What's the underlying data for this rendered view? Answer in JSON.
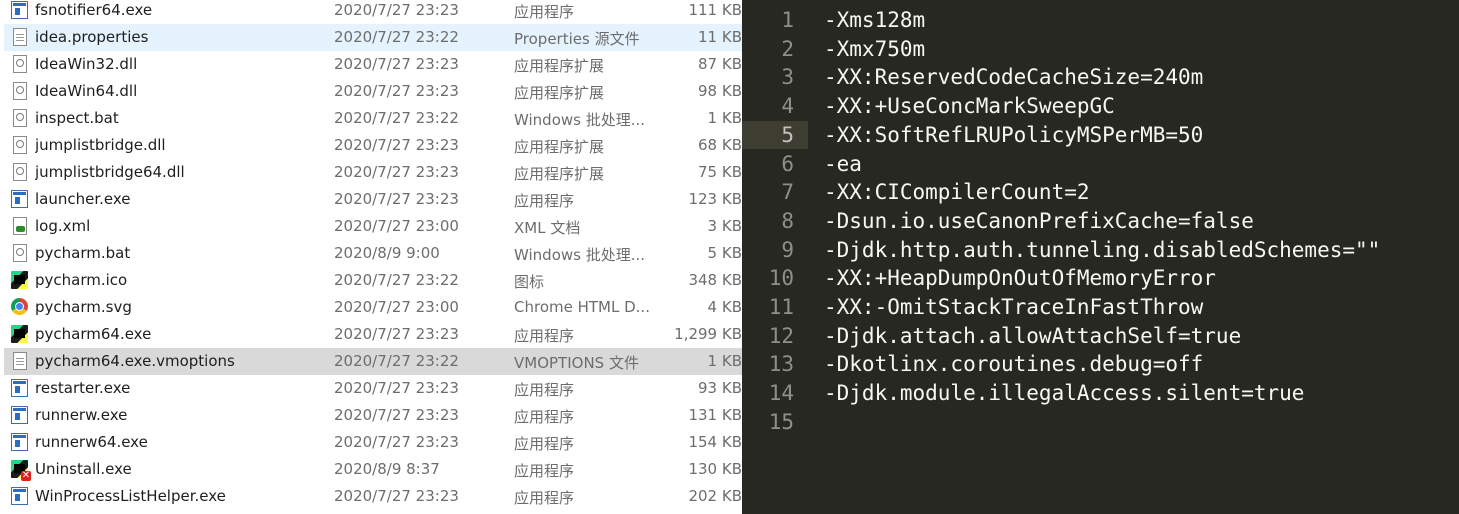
{
  "explorer": {
    "files": [
      {
        "name": "fsnotifier64.exe",
        "date": "2020/7/27 23:23",
        "type": "应用程序",
        "size": "111 KB",
        "icon": "exe-icon"
      },
      {
        "name": "idea.properties",
        "date": "2020/7/27 23:22",
        "type": "Properties 源文件",
        "size": "11 KB",
        "icon": "doc-icon",
        "state": "selected"
      },
      {
        "name": "IdeaWin32.dll",
        "date": "2020/7/27 23:23",
        "type": "应用程序扩展",
        "size": "87 KB",
        "icon": "dll-icon"
      },
      {
        "name": "IdeaWin64.dll",
        "date": "2020/7/27 23:23",
        "type": "应用程序扩展",
        "size": "98 KB",
        "icon": "dll-icon"
      },
      {
        "name": "inspect.bat",
        "date": "2020/7/27 23:22",
        "type": "Windows 批处理...",
        "size": "1 KB",
        "icon": "bat-icon"
      },
      {
        "name": "jumplistbridge.dll",
        "date": "2020/7/27 23:23",
        "type": "应用程序扩展",
        "size": "68 KB",
        "icon": "dll-icon"
      },
      {
        "name": "jumplistbridge64.dll",
        "date": "2020/7/27 23:23",
        "type": "应用程序扩展",
        "size": "75 KB",
        "icon": "dll-icon"
      },
      {
        "name": "launcher.exe",
        "date": "2020/7/27 23:23",
        "type": "应用程序",
        "size": "123 KB",
        "icon": "exe-icon"
      },
      {
        "name": "log.xml",
        "date": "2020/7/27 23:00",
        "type": "XML 文档",
        "size": "3 KB",
        "icon": "xml-icon"
      },
      {
        "name": "pycharm.bat",
        "date": "2020/8/9 9:00",
        "type": "Windows 批处理...",
        "size": "5 KB",
        "icon": "bat-icon"
      },
      {
        "name": "pycharm.ico",
        "date": "2020/7/27 23:22",
        "type": "图标",
        "size": "348 KB",
        "icon": "pycharm-icon"
      },
      {
        "name": "pycharm.svg",
        "date": "2020/7/27 23:00",
        "type": "Chrome HTML D...",
        "size": "4 KB",
        "icon": "chrome-icon"
      },
      {
        "name": "pycharm64.exe",
        "date": "2020/7/27 23:23",
        "type": "应用程序",
        "size": "1,299 KB",
        "icon": "pycharm-icon"
      },
      {
        "name": "pycharm64.exe.vmoptions",
        "date": "2020/7/27 23:22",
        "type": "VMOPTIONS 文件",
        "size": "1 KB",
        "icon": "doc-icon",
        "state": "hovered"
      },
      {
        "name": "restarter.exe",
        "date": "2020/7/27 23:23",
        "type": "应用程序",
        "size": "93 KB",
        "icon": "exe-icon"
      },
      {
        "name": "runnerw.exe",
        "date": "2020/7/27 23:23",
        "type": "应用程序",
        "size": "131 KB",
        "icon": "exe-icon"
      },
      {
        "name": "runnerw64.exe",
        "date": "2020/7/27 23:23",
        "type": "应用程序",
        "size": "154 KB",
        "icon": "exe-icon"
      },
      {
        "name": "Uninstall.exe",
        "date": "2020/8/9 8:37",
        "type": "应用程序",
        "size": "130 KB",
        "icon": "uninstall-icon"
      },
      {
        "name": "WinProcessListHelper.exe",
        "date": "2020/7/27 23:23",
        "type": "应用程序",
        "size": "202 KB",
        "icon": "exe-icon"
      }
    ]
  },
  "editor": {
    "current_line": 5,
    "lines": [
      "-Xms128m",
      "-Xmx750m",
      "-XX:ReservedCodeCacheSize=240m",
      "-XX:+UseConcMarkSweepGC",
      "-XX:SoftRefLRUPolicyMSPerMB=50",
      "-ea",
      "-XX:CICompilerCount=2",
      "-Dsun.io.useCanonPrefixCache=false",
      "-Djdk.http.auth.tunneling.disabledSchemes=\"\"",
      "-XX:+HeapDumpOnOutOfMemoryError",
      "-XX:-OmitStackTraceInFastThrow",
      "-Djdk.attach.allowAttachSelf=true",
      "-Dkotlinx.coroutines.debug=off",
      "-Djdk.module.illegalAccess.silent=true",
      ""
    ]
  }
}
